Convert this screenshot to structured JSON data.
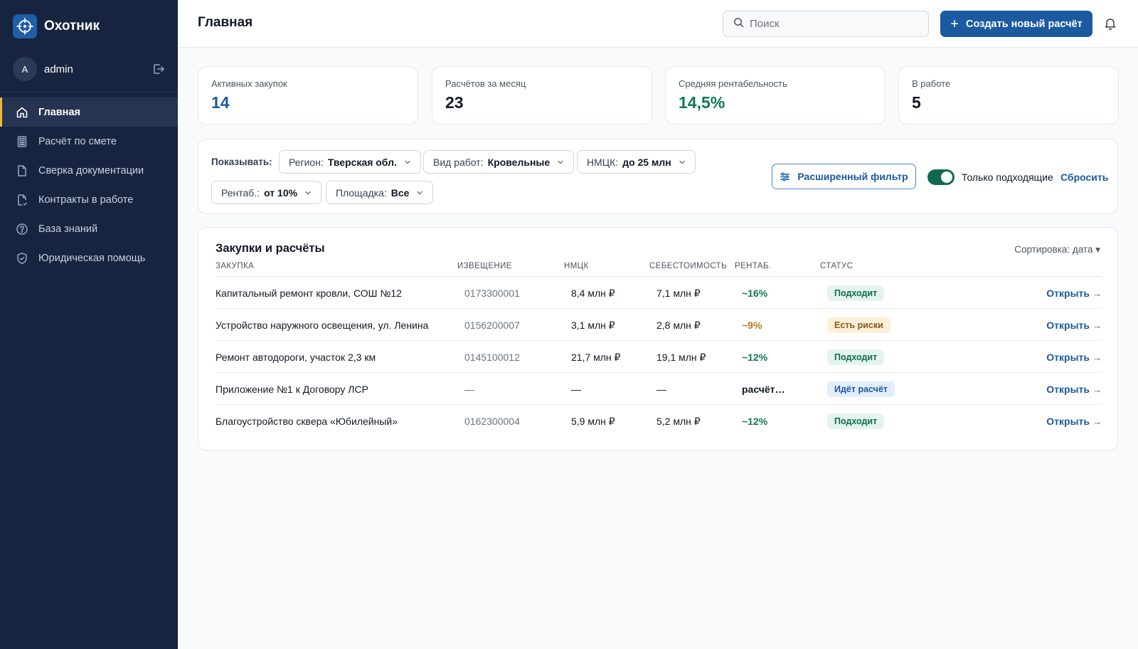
{
  "app": {
    "name": "Охотник"
  },
  "user": {
    "initial": "A",
    "name": "admin"
  },
  "sidebar": {
    "items": [
      {
        "label": "Главная",
        "icon": "home-icon",
        "active": true
      },
      {
        "label": "Расчёт по смете",
        "icon": "calculator-icon",
        "active": false
      },
      {
        "label": "Сверка документации",
        "icon": "document-icon",
        "active": false
      },
      {
        "label": "Контракты в работе",
        "icon": "contract-icon",
        "active": false
      },
      {
        "label": "База знаний",
        "icon": "help-circle-icon",
        "active": false
      },
      {
        "label": "Юридическая помощь",
        "icon": "shield-check-icon",
        "active": false
      }
    ]
  },
  "header": {
    "title": "Главная",
    "search_placeholder": "Поиск",
    "create_label": "Создать новый расчёт"
  },
  "stats": [
    {
      "label": "Активных закупок",
      "value": "14",
      "color": "#1b5aa0"
    },
    {
      "label": "Расчётов за месяц",
      "value": "23",
      "color": "#111827"
    },
    {
      "label": "Средняя рентабельность",
      "value": "14,5%",
      "color": "#0f7a52"
    },
    {
      "label": "В работе",
      "value": "5",
      "color": "#111827"
    }
  ],
  "filters": {
    "show_label": "Показывать:",
    "chips": [
      {
        "label": "Регион:",
        "value": "Тверская обл."
      },
      {
        "label": "Вид работ:",
        "value": "Кровельные"
      },
      {
        "label": "НМЦК:",
        "value": "до 25 млн"
      },
      {
        "label": "Рентаб.:",
        "value": "от 10%"
      },
      {
        "label": "Площадка:",
        "value": "Все"
      }
    ],
    "advanced_label": "Расширенный фильтр",
    "toggle_label": "Только подходящие",
    "toggle_on": true,
    "reset_label": "Сбросить"
  },
  "table": {
    "title": "Закупки и расчёты",
    "sort_label": "Сортировка: дата ▾",
    "columns": [
      "Закупка",
      "Извещение",
      "НМЦК",
      "Себестоимость",
      "Рентаб.",
      "Статус"
    ],
    "open_label": "Открыть",
    "open_arrow": "→",
    "rows": [
      {
        "name": "Капитальный ремонт кровли, СОШ №12",
        "notice": "0173300001",
        "nmck": "8,4 млн ₽",
        "cost": "7,1 млн ₽",
        "rent": "~16%",
        "rent_color": "#0f7a52",
        "status": "Подходит",
        "status_bg": "#e3f4ec",
        "status_color": "#0f6b4f"
      },
      {
        "name": "Устройство наружного освещения, ул. Ленина",
        "notice": "0156200007",
        "nmck": "3,1 млн ₽",
        "cost": "2,8 млн ₽",
        "rent": "~9%",
        "rent_color": "#b7791f",
        "status": "Есть риски",
        "status_bg": "#fdf0d8",
        "status_color": "#8a5a12"
      },
      {
        "name": "Ремонт автодороги, участок 2,3 км",
        "notice": "0145100012",
        "nmck": "21,7 млн ₽",
        "cost": "19,1 млн ₽",
        "rent": "~12%",
        "rent_color": "#0f7a52",
        "status": "Подходит",
        "status_bg": "#e3f4ec",
        "status_color": "#0f6b4f"
      },
      {
        "name": "Приложение №1 к Договору ЛСР",
        "notice": "—",
        "nmck": "—",
        "cost": "—",
        "rent": "расчёт…",
        "rent_color": "#111827",
        "status": "Идёт расчёт",
        "status_bg": "#e3eefb",
        "status_color": "#1b5aa0"
      },
      {
        "name": "Благоустройство сквера «Юбилейный»",
        "notice": "0162300004",
        "nmck": "5,9 млн ₽",
        "cost": "5,2 млн ₽",
        "rent": "~12%",
        "rent_color": "#0f7a52",
        "status": "Подходит",
        "status_bg": "#e3f4ec",
        "status_color": "#0f6b4f"
      }
    ]
  }
}
